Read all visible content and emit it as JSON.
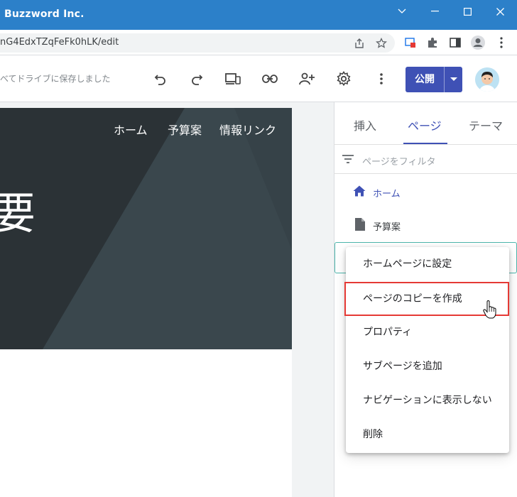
{
  "window": {
    "title": "Buzzword Inc."
  },
  "browser": {
    "url": "nG4EdxTZqFeFk0hLK/edit"
  },
  "editor": {
    "save_status": "べてドライブに保存しました",
    "publish_label": "公開"
  },
  "site": {
    "nav": [
      "ホーム",
      "予算案",
      "情報リンク"
    ],
    "hero_text": "要"
  },
  "panel": {
    "tabs": [
      "挿入",
      "ページ",
      "テーマ"
    ],
    "active_tab": "ページ",
    "filter_placeholder": "ページをフィルタ",
    "pages": [
      {
        "label": "ホーム",
        "icon": "home-icon",
        "is_home": true
      },
      {
        "label": "予算案",
        "icon": "page-icon",
        "is_home": false
      }
    ]
  },
  "context_menu": {
    "items": [
      "ホームページに設定",
      "ページのコピーを作成",
      "プロパティ",
      "サブページを追加",
      "ナビゲーションに表示しない",
      "削除"
    ],
    "highlighted_index": 1
  },
  "colors": {
    "titlebar": "#2c80c9",
    "accent": "#3f51b5",
    "highlight_border": "#e53935",
    "hero_bg": "#2f3a3f"
  }
}
